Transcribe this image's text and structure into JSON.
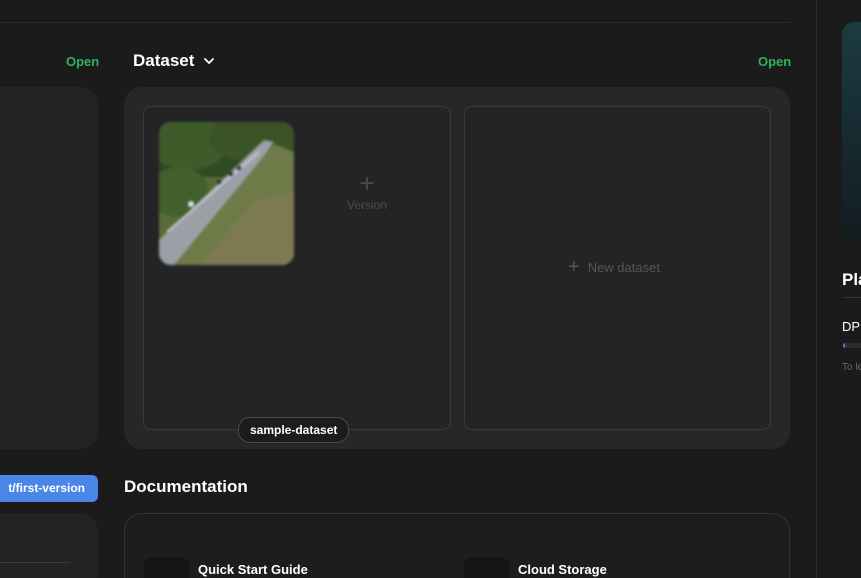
{
  "left_column": {
    "open_label": "Open",
    "version_chip": "t/first-version"
  },
  "dataset": {
    "title": "Dataset",
    "open_label": "Open",
    "add_version_label": "Version",
    "new_dataset_label": "New dataset",
    "card_name": "sample-dataset",
    "thumbnail_icon": "park-path-photo"
  },
  "documentation": {
    "title": "Documentation",
    "items": [
      {
        "label": "Quick Start Guide",
        "icon": "book-icon"
      },
      {
        "label": "Cloud Storage",
        "icon": "cloud-storage-icon"
      }
    ]
  },
  "sidebar": {
    "heading": "Pla",
    "usage_label": "DP",
    "usage_fraction": 0.06,
    "hint": "To le"
  },
  "colors": {
    "accent_green": "#2fb35a",
    "accent_blue": "#4a86e8",
    "background": "#1b1b1c"
  }
}
